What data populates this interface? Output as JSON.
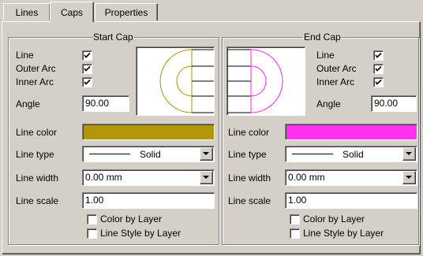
{
  "tabs": [
    {
      "label": "Lines"
    },
    {
      "label": "Caps"
    },
    {
      "label": "Properties"
    }
  ],
  "start_cap": {
    "title": "Start Cap",
    "line_label": "Line",
    "outer_arc_label": "Outer Arc",
    "inner_arc_label": "Inner Arc",
    "line_checked": true,
    "outer_arc_checked": true,
    "inner_arc_checked": true,
    "angle_label": "Angle",
    "angle_value": "90.00",
    "preview_color": "#b09010",
    "line_color_label": "Line color",
    "line_color": "#b4960a",
    "line_type_label": "Line type",
    "line_type_value": "Solid",
    "line_width_label": "Line width",
    "line_width_value": "0.00 mm",
    "line_scale_label": "Line scale",
    "line_scale_value": "1.00",
    "color_by_layer_label": "Color by Layer",
    "color_by_layer_checked": false,
    "line_style_by_layer_label": "Line Style by Layer",
    "line_style_by_layer_checked": false
  },
  "end_cap": {
    "title": "End Cap",
    "line_label": "Line",
    "outer_arc_label": "Outer Arc",
    "inner_arc_label": "Inner Arc",
    "line_checked": true,
    "outer_arc_checked": true,
    "inner_arc_checked": true,
    "angle_label": "Angle",
    "angle_value": "90.00",
    "preview_color": "#ff20ff",
    "line_color_label": "Line color",
    "line_color": "#ff30f0",
    "line_type_label": "Line type",
    "line_type_value": "Solid",
    "line_width_label": "Line width",
    "line_width_value": "0.00 mm",
    "line_scale_label": "Line scale",
    "line_scale_value": "1.00",
    "color_by_layer_label": "Color by Layer",
    "color_by_layer_checked": false,
    "line_style_by_layer_label": "Line Style by Layer",
    "line_style_by_layer_checked": false
  }
}
